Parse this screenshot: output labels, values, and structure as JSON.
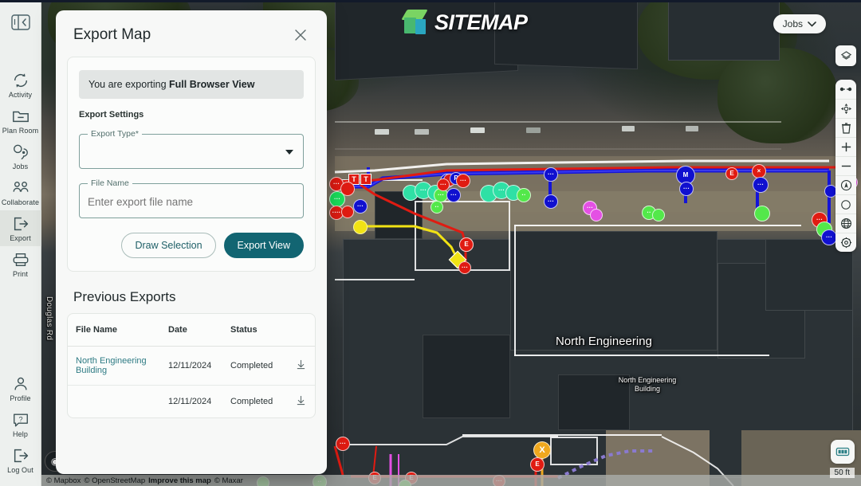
{
  "app": {
    "brand_name": "SITEMAP",
    "brand_icon": "cube-logo-icon"
  },
  "sidebar": {
    "toggle_icon": "panel-collapse-icon",
    "items": [
      {
        "label": "Activity",
        "icon": "activity-refresh-icon",
        "active": false
      },
      {
        "label": "Plan Room",
        "icon": "folder-icon",
        "active": false
      },
      {
        "label": "Jobs",
        "icon": "map-pin-icon",
        "active": false
      },
      {
        "label": "Collaborate",
        "icon": "people-icon",
        "active": false
      },
      {
        "label": "Export",
        "icon": "export-arrow-icon",
        "active": true
      },
      {
        "label": "Print",
        "icon": "printer-icon",
        "active": false
      }
    ],
    "bottom_items": [
      {
        "label": "Profile",
        "icon": "user-icon"
      },
      {
        "label": "Help",
        "icon": "question-bubble-icon"
      },
      {
        "label": "Log Out",
        "icon": "logout-arrow-icon"
      }
    ]
  },
  "modal": {
    "title": "Export Map",
    "close_icon": "close-icon",
    "banner_prefix": "You are exporting ",
    "banner_strong": "Full Browser View",
    "settings_label": "Export Settings",
    "export_type": {
      "legend": "Export Type",
      "required_mark": "*",
      "value": "",
      "caret_icon": "chevron-down-icon"
    },
    "file_name": {
      "legend": "File Name",
      "value": "",
      "placeholder": "Enter export file name"
    },
    "buttons": {
      "draw_selection": "Draw Selection",
      "export_view": "Export View"
    },
    "previous_exports": {
      "title": "Previous Exports",
      "columns": [
        "File Name",
        "Date",
        "Status",
        ""
      ],
      "download_icon": "download-arrow-icon",
      "rows": [
        {
          "file_name": "North Engineering Building",
          "date": "12/11/2024",
          "status": "Completed"
        },
        {
          "file_name": "",
          "date": "12/11/2024",
          "status": "Completed"
        }
      ]
    }
  },
  "map_controls": {
    "jobs_button": {
      "label": "Jobs",
      "icon": "chevron-down-icon"
    },
    "layers_icon": "layers-icon",
    "tools": [
      "measure-distance-icon",
      "move-icon",
      "trash-icon",
      "zoom-in-icon",
      "zoom-out-icon",
      "compass-north-icon",
      "circle-draw-icon",
      "globe-icon",
      "settings-gear-icon"
    ],
    "scale_icon": "scale-bar-icon",
    "scale_label": "50 ft",
    "compass_icon": "compass-icon"
  },
  "map": {
    "labels": [
      {
        "text": "North Engineering",
        "size": 15
      },
      {
        "text": "North Engineering Building",
        "size": 9
      }
    ],
    "street_label": "Douglas Rd",
    "attribution": {
      "mapbox": "© Mapbox",
      "osm": "© OpenStreetMap",
      "improve": "Improve this map",
      "maxar": "© Maxar"
    }
  },
  "colors": {
    "accent_teal": "#126572",
    "link_teal": "#2e7b84",
    "sidebar_bg": "#edf0ee",
    "modal_bg": "#f7f8f7",
    "field_border": "#7fa09c",
    "marker_red": "#e01b12",
    "marker_blue": "#1010cf",
    "marker_green": "#19e05c",
    "marker_yellow": "#f2e314",
    "marker_magenta": "#e450e4",
    "marker_orange": "#f0a81e"
  }
}
